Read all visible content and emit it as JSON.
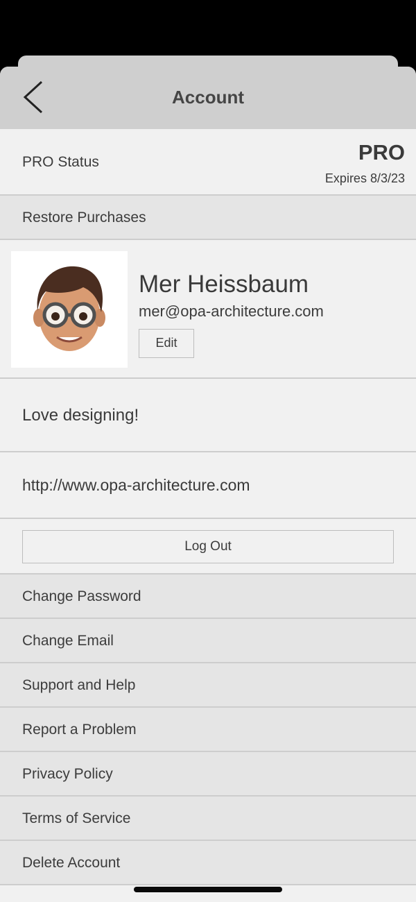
{
  "header": {
    "title": "Account"
  },
  "pro": {
    "label": "PRO Status",
    "badge": "PRO",
    "expires": "Expires 8/3/23"
  },
  "restore": {
    "label": "Restore Purchases"
  },
  "profile": {
    "name": "Mer Heissbaum",
    "email": "mer@opa-architecture.com",
    "edit_label": "Edit"
  },
  "bio": "Love designing!",
  "website": "http://www.opa-architecture.com",
  "logout_label": "Log Out",
  "menu": [
    {
      "label": "Change Password"
    },
    {
      "label": "Change Email"
    },
    {
      "label": "Support and Help"
    },
    {
      "label": "Report a Problem"
    },
    {
      "label": "Privacy Policy"
    },
    {
      "label": "Terms of Service"
    },
    {
      "label": "Delete Account"
    }
  ]
}
